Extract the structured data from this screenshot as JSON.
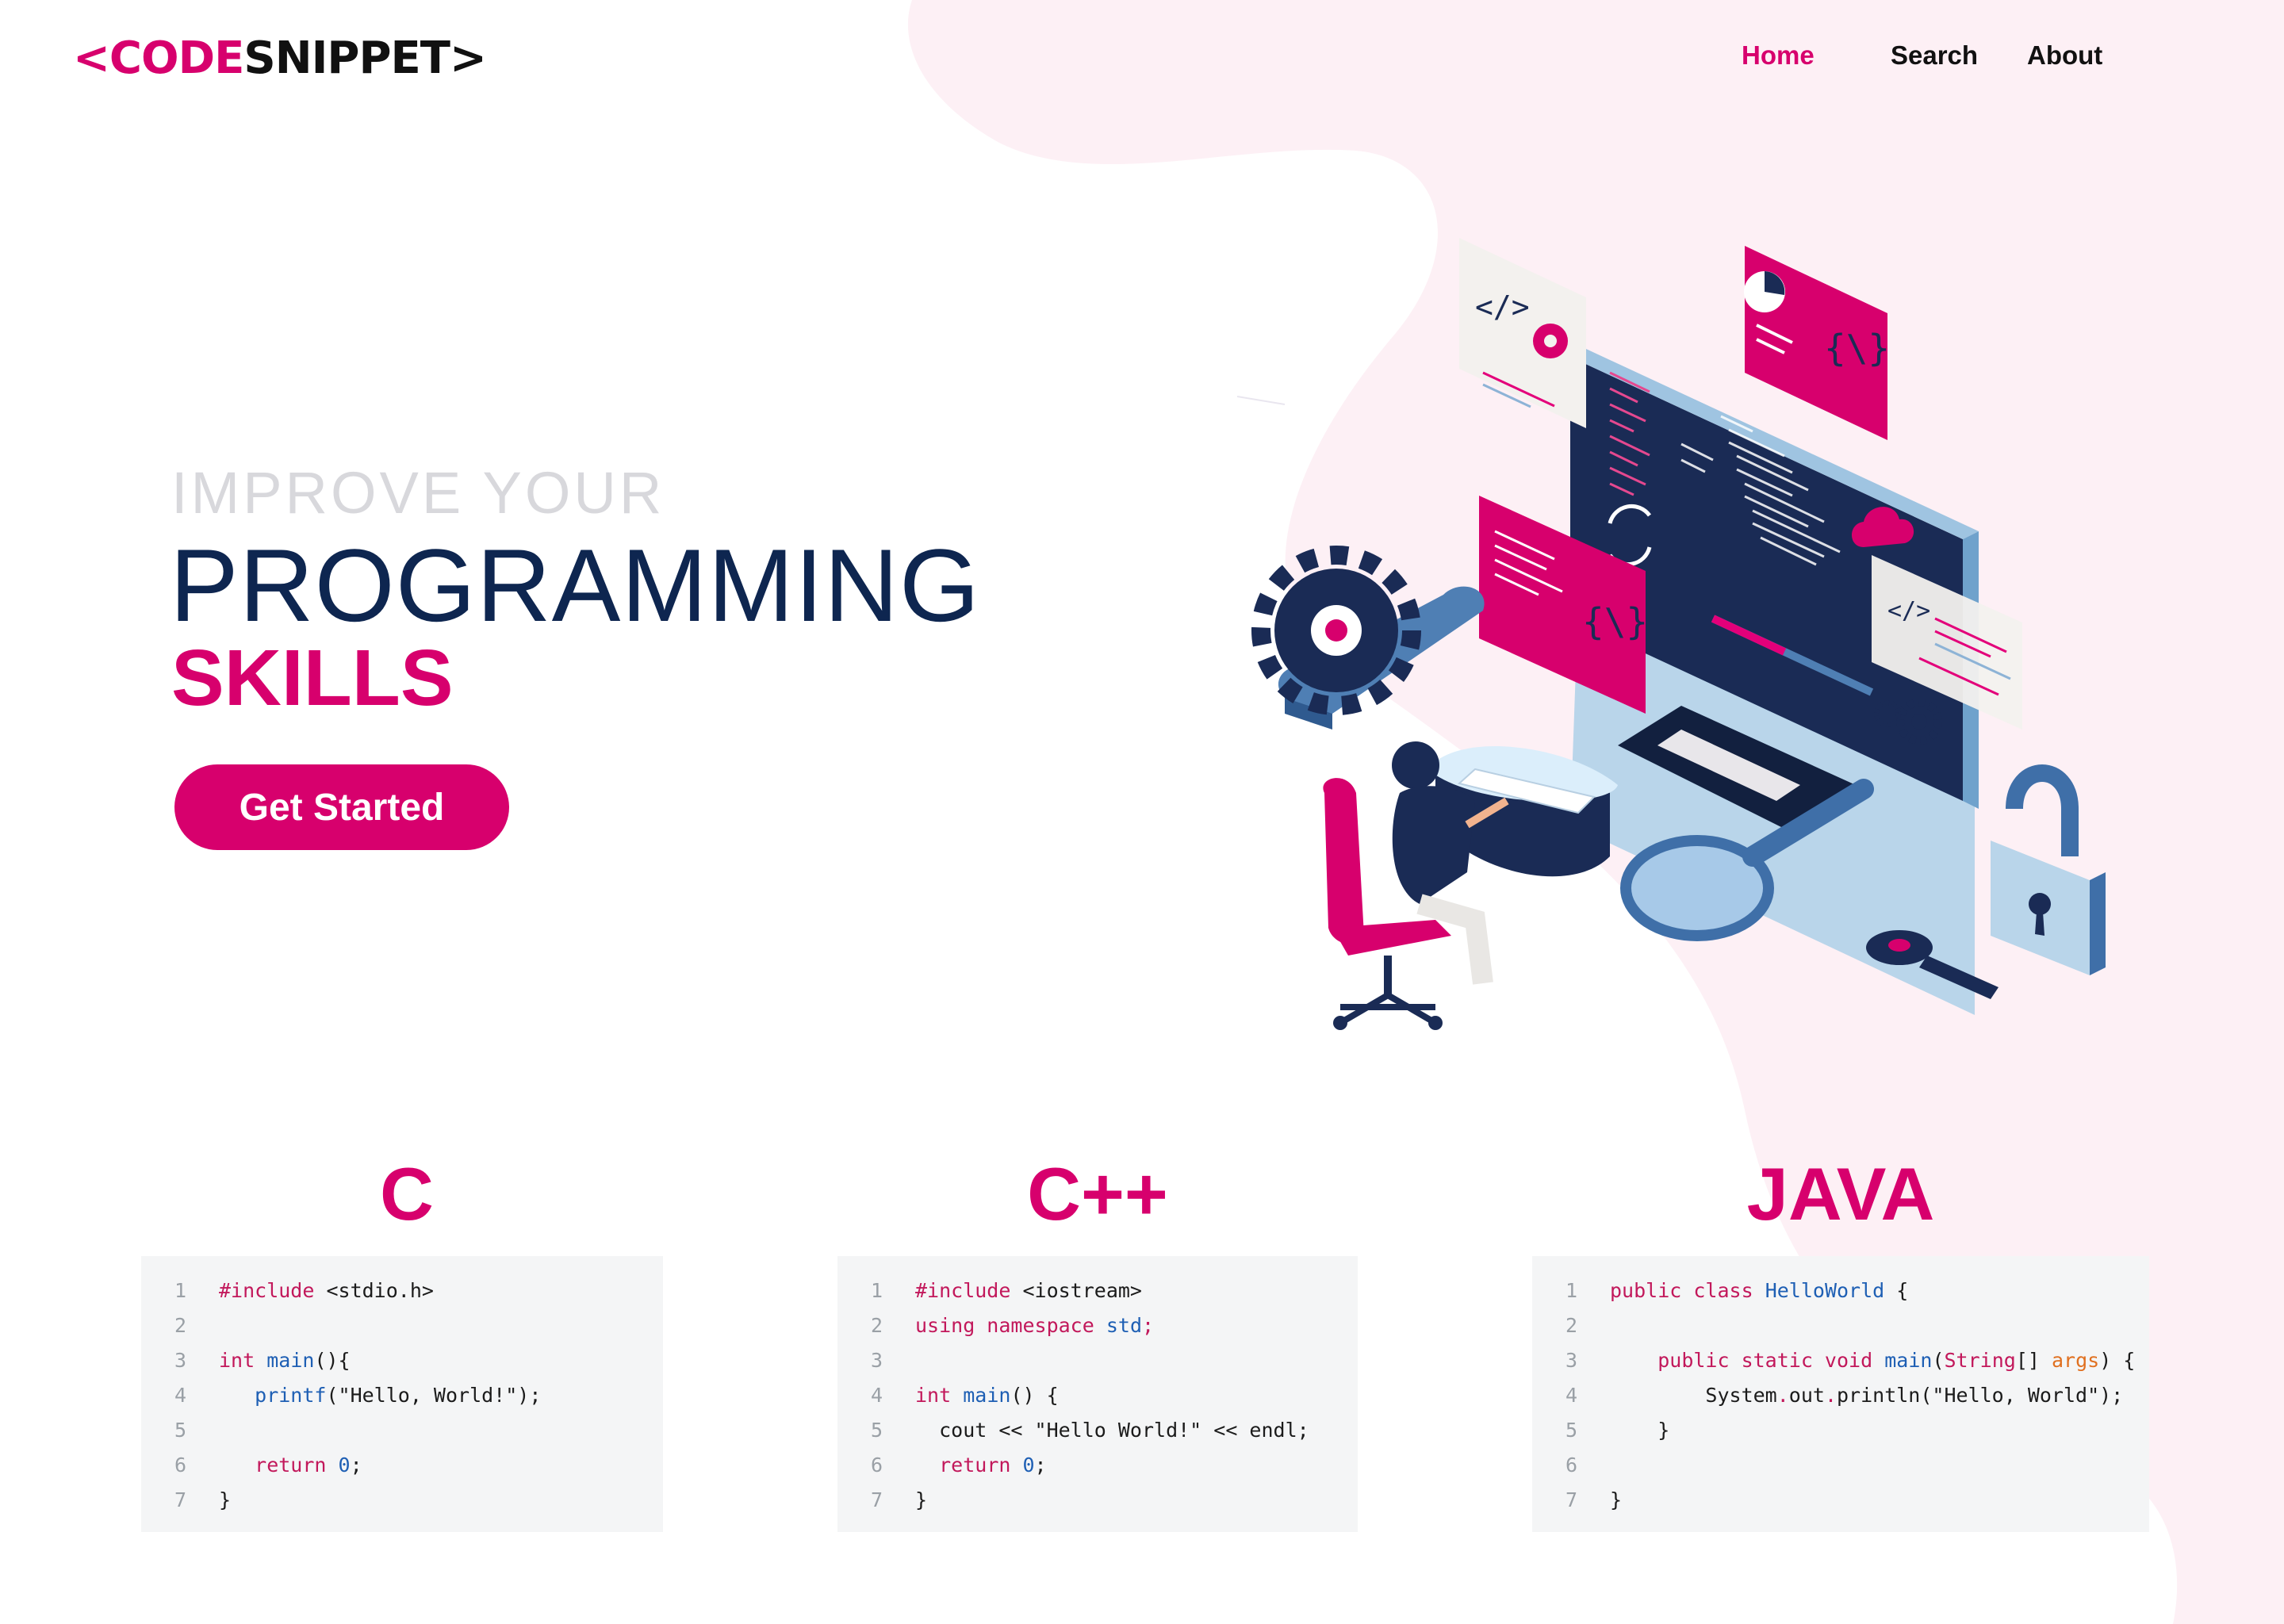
{
  "brand": {
    "logo_left": "<CODE",
    "logo_right": "SNIPPET>"
  },
  "nav": {
    "home": "Home",
    "search": "Search",
    "about": "About"
  },
  "hero": {
    "subtitle": "IMPROVE YOUR",
    "title": "PROGRAMMING",
    "accent": "SKILLS",
    "cta_label": "Get Started"
  },
  "illustration": {
    "description": "isometric programmer workstation with monitor, gears, padlock, key and magnifier",
    "code_tag": "</>",
    "brace_tag": "{\\}"
  },
  "colors": {
    "accent": "#d7006d",
    "navy": "#0e2650",
    "blob": "#fdf0f5",
    "code_bg": "#f4f5f6",
    "keyword": "#c2185b",
    "function": "#1e5fb4",
    "number": "#1e5fb4",
    "string": "#1b1b1b"
  },
  "snippets": [
    {
      "language": "C",
      "lines": [
        {
          "num": "1",
          "parts": [
            {
              "t": "#include",
              "c": "kw"
            },
            {
              "t": " <stdio.h>",
              "c": "tx"
            }
          ]
        },
        {
          "num": "2",
          "parts": []
        },
        {
          "num": "3",
          "parts": [
            {
              "t": "int",
              "c": "kw"
            },
            {
              "t": " ",
              "c": "tx"
            },
            {
              "t": "main",
              "c": "fn"
            },
            {
              "t": "(){",
              "c": "tx"
            }
          ]
        },
        {
          "num": "4",
          "parts": [
            {
              "t": "   ",
              "c": "tx"
            },
            {
              "t": "printf",
              "c": "fn"
            },
            {
              "t": "(\"Hello, World!\");",
              "c": "tx"
            }
          ]
        },
        {
          "num": "5",
          "parts": []
        },
        {
          "num": "6",
          "parts": [
            {
              "t": "   ",
              "c": "tx"
            },
            {
              "t": "return",
              "c": "kw"
            },
            {
              "t": " ",
              "c": "tx"
            },
            {
              "t": "0",
              "c": "num"
            },
            {
              "t": ";",
              "c": "tx"
            }
          ]
        },
        {
          "num": "7",
          "parts": [
            {
              "t": "}",
              "c": "tx"
            }
          ]
        }
      ]
    },
    {
      "language": "C++",
      "lines": [
        {
          "num": "1",
          "parts": [
            {
              "t": "#include",
              "c": "kw"
            },
            {
              "t": " <iostream>",
              "c": "tx"
            }
          ]
        },
        {
          "num": "2",
          "parts": [
            {
              "t": "using namespace",
              "c": "kw"
            },
            {
              "t": " ",
              "c": "tx"
            },
            {
              "t": "std",
              "c": "fn"
            },
            {
              "t": ";",
              "c": "kw"
            }
          ]
        },
        {
          "num": "3",
          "parts": []
        },
        {
          "num": "4",
          "parts": [
            {
              "t": "int",
              "c": "kw"
            },
            {
              "t": " ",
              "c": "tx"
            },
            {
              "t": "main",
              "c": "fn"
            },
            {
              "t": "() {",
              "c": "tx"
            }
          ]
        },
        {
          "num": "5",
          "parts": [
            {
              "t": "  cout << \"Hello World!\" << endl;",
              "c": "tx"
            }
          ]
        },
        {
          "num": "6",
          "parts": [
            {
              "t": "  ",
              "c": "tx"
            },
            {
              "t": "return",
              "c": "kw"
            },
            {
              "t": " ",
              "c": "tx"
            },
            {
              "t": "0",
              "c": "num"
            },
            {
              "t": ";",
              "c": "tx"
            }
          ]
        },
        {
          "num": "7",
          "parts": [
            {
              "t": "}",
              "c": "tx"
            }
          ]
        }
      ]
    },
    {
      "language": "JAVA",
      "lines": [
        {
          "num": "1",
          "parts": [
            {
              "t": "public class",
              "c": "kw"
            },
            {
              "t": " ",
              "c": "tx"
            },
            {
              "t": "HelloWorld",
              "c": "fn"
            },
            {
              "t": " {",
              "c": "tx"
            }
          ]
        },
        {
          "num": "2",
          "parts": []
        },
        {
          "num": "3",
          "parts": [
            {
              "t": "    ",
              "c": "tx"
            },
            {
              "t": "public static void",
              "c": "kw"
            },
            {
              "t": " ",
              "c": "tx"
            },
            {
              "t": "main",
              "c": "fn"
            },
            {
              "t": "(",
              "c": "tx"
            },
            {
              "t": "String",
              "c": "kw"
            },
            {
              "t": "[] ",
              "c": "tx"
            },
            {
              "t": "args",
              "c": "param"
            },
            {
              "t": ") {",
              "c": "tx"
            }
          ]
        },
        {
          "num": "4",
          "parts": [
            {
              "t": "        System",
              "c": "tx"
            },
            {
              "t": ".",
              "c": "kw"
            },
            {
              "t": "out",
              "c": "tx"
            },
            {
              "t": ".",
              "c": "kw"
            },
            {
              "t": "println(\"Hello, World\");",
              "c": "tx"
            }
          ]
        },
        {
          "num": "5",
          "parts": [
            {
              "t": "    }",
              "c": "tx"
            }
          ]
        },
        {
          "num": "6",
          "parts": []
        },
        {
          "num": "7",
          "parts": [
            {
              "t": "}",
              "c": "tx"
            }
          ]
        }
      ]
    }
  ]
}
